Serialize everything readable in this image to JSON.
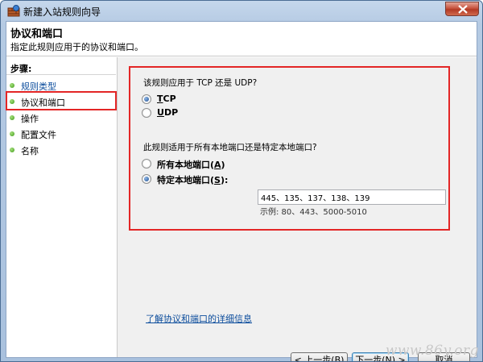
{
  "window": {
    "title": "新建入站规则向导"
  },
  "header": {
    "title": "协议和端口",
    "subtitle": "指定此规则应用于的协议和端口。"
  },
  "steps": {
    "title": "步骤:",
    "items": [
      {
        "label": "规则类型",
        "state": "done"
      },
      {
        "label": "协议和端口",
        "state": "current"
      },
      {
        "label": "操作",
        "state": "pending"
      },
      {
        "label": "配置文件",
        "state": "pending"
      },
      {
        "label": "名称",
        "state": "pending"
      }
    ]
  },
  "protocol": {
    "question": "该规则应用于 TCP 还是 UDP?",
    "tcp_label": "TCP",
    "tcp_underline": "T",
    "tcp_rest": "CP",
    "udp_label": "UDP",
    "udp_underline": "U",
    "udp_rest": "DP",
    "selected": "TCP"
  },
  "ports": {
    "question": "此规则适用于所有本地端口还是特定本地端口?",
    "all_label": "所有本地端口",
    "all_key": "A",
    "specific_label": "特定本地端口",
    "specific_key": "S",
    "selected": "specific",
    "value": "445、135、137、138、139",
    "example": "示例: 80、443、5000-5010"
  },
  "link_text": "了解协议和端口的详细信息",
  "buttons": {
    "back": "< 上一步(B)",
    "next": "下一步(N) >",
    "cancel": "取消"
  },
  "watermark": "www.86y.org",
  "colors": {
    "highlight": "#e32626",
    "link": "#0b4c9c",
    "step_done": "#3c9b17"
  }
}
